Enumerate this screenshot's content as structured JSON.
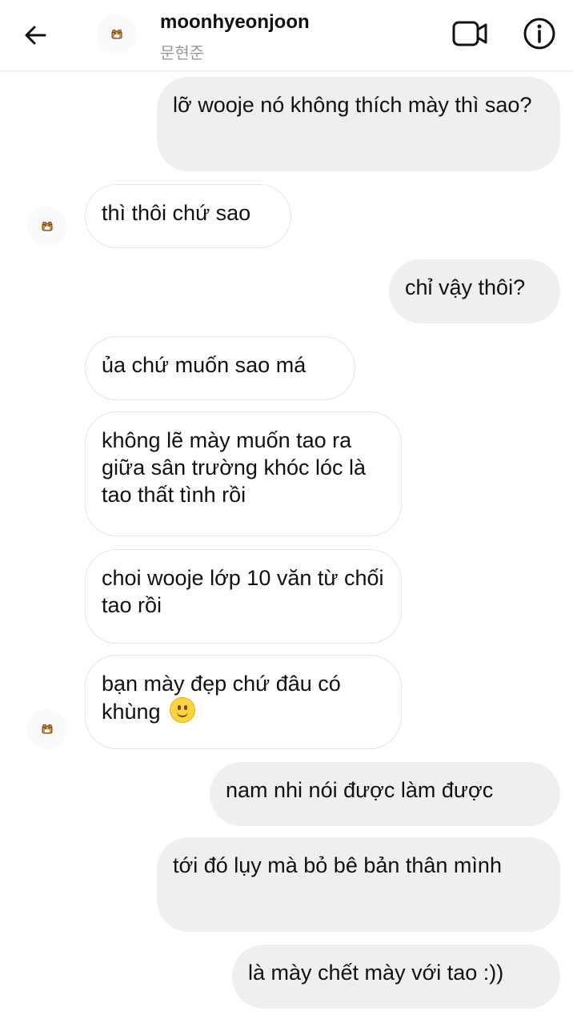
{
  "header": {
    "username": "moonhyeonjoon",
    "display_name": "문현준"
  },
  "messages": [
    {
      "dir": "out",
      "text": "lỡ wooje nó không thích mày thì sao?"
    },
    {
      "dir": "in",
      "text": "thì thôi chứ sao"
    },
    {
      "dir": "out",
      "text": "chỉ vậy thôi?"
    },
    {
      "dir": "in",
      "text": "ủa chứ muốn sao má"
    },
    {
      "dir": "in",
      "text": "không lẽ mày muốn tao ra giữa sân trường khóc lóc là tao thất tình rồi"
    },
    {
      "dir": "in",
      "text": "choi wooje lớp 10 văn từ chối tao rồi"
    },
    {
      "dir": "in",
      "text": "bạn mày đẹp chứ đâu có khùng",
      "emoji": "slightly-smiling-face"
    },
    {
      "dir": "out",
      "text": "nam nhi nói được làm được"
    },
    {
      "dir": "out",
      "text": "tới đó lụy mà bỏ bê bản thân mình"
    },
    {
      "dir": "out",
      "text": "là mày chết mày với tao :))"
    }
  ]
}
